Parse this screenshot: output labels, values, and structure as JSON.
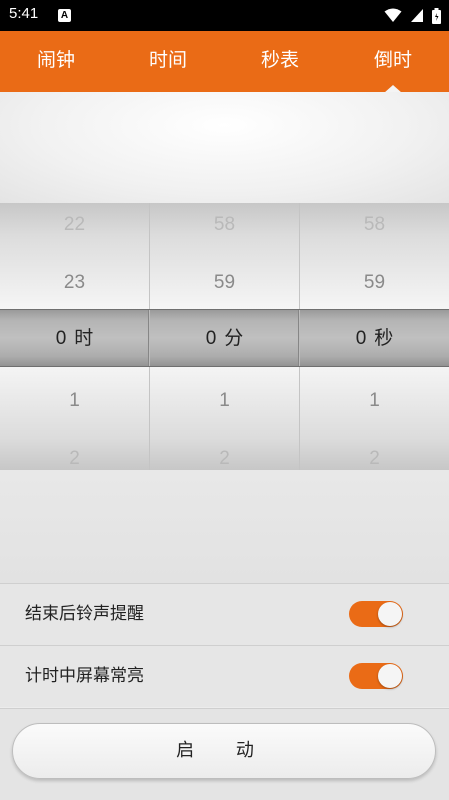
{
  "status_bar": {
    "time": "5:41",
    "notification_icon": "A",
    "icons": [
      "wifi-icon",
      "cell-signal-icon",
      "battery-icon"
    ]
  },
  "tabs": [
    {
      "label": "闹钟",
      "selected": false
    },
    {
      "label": "时间",
      "selected": false
    },
    {
      "label": "秒表",
      "selected": false
    },
    {
      "label": "倒时",
      "selected": true
    }
  ],
  "picker": {
    "hours": {
      "items": [
        "22",
        "23",
        "0",
        "1",
        "2"
      ],
      "selected": "0",
      "unit": "时"
    },
    "minutes": {
      "items": [
        "58",
        "59",
        "0",
        "1",
        "2"
      ],
      "selected": "0",
      "unit": "分"
    },
    "seconds": {
      "items": [
        "58",
        "59",
        "0",
        "1",
        "2"
      ],
      "selected": "0",
      "unit": "秒"
    }
  },
  "settings": [
    {
      "label": "结束后铃声提醒",
      "enabled": true
    },
    {
      "label": "计时中屏幕常亮",
      "enabled": true
    }
  ],
  "start_button": {
    "label": "启 动"
  },
  "colors": {
    "accent": "#ea6b16",
    "status_bar": "#000000"
  }
}
